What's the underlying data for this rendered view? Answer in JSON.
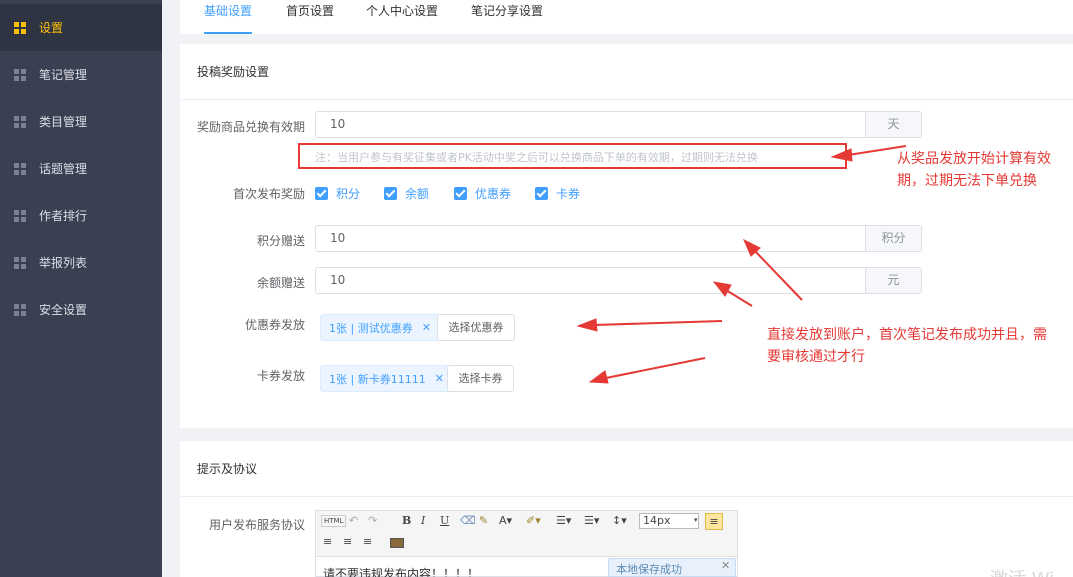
{
  "sidebar": {
    "items": [
      {
        "label": "设置",
        "active": true
      },
      {
        "label": "笔记管理"
      },
      {
        "label": "类目管理"
      },
      {
        "label": "话题管理"
      },
      {
        "label": "作者排行"
      },
      {
        "label": "举报列表"
      },
      {
        "label": "安全设置"
      }
    ]
  },
  "tabs": [
    "基础设置",
    "首页设置",
    "个人中心设置",
    "笔记分享设置"
  ],
  "reward": {
    "title": "投稿奖励设置",
    "validity": {
      "label": "奖励商品兑换有效期",
      "value": "10",
      "unit": "天"
    },
    "note": "注：当用户参与有奖征集或者PK活动中奖之后可以兑换商品下单的有效期，过期则无法兑换",
    "first_publish": {
      "label": "首次发布奖励",
      "options": [
        "积分",
        "余额",
        "优惠券",
        "卡券"
      ]
    },
    "points": {
      "label": "积分赠送",
      "value": "10",
      "unit": "积分"
    },
    "balance": {
      "label": "余额赠送",
      "value": "10",
      "unit": "元"
    },
    "coupon": {
      "label": "优惠券发放",
      "tag": "1张 | 测试优惠券",
      "button": "选择优惠券"
    },
    "card": {
      "label": "卡券发放",
      "tag": "1张 | 新卡券11111",
      "button": "选择卡券"
    }
  },
  "annotations": {
    "validity_line1": "从奖品发放开始计算有效",
    "validity_line2": "期，过期无法下单兑换",
    "direct_line1": "直接发放到账户，首次笔记发布成功并且，需",
    "direct_line2": "要审核通过才行"
  },
  "tips": {
    "title": "提示及协议",
    "agreement_label": "用户发布服务协议",
    "font_size": "14px",
    "editor_text": "请不要违规发布内容！！！！",
    "toast": "本地保存成功",
    "watermark": "激活 Wi"
  },
  "colors": {
    "accent": "#409eff",
    "active_sidebar": "#ffc107",
    "annotation": "#e53935"
  }
}
